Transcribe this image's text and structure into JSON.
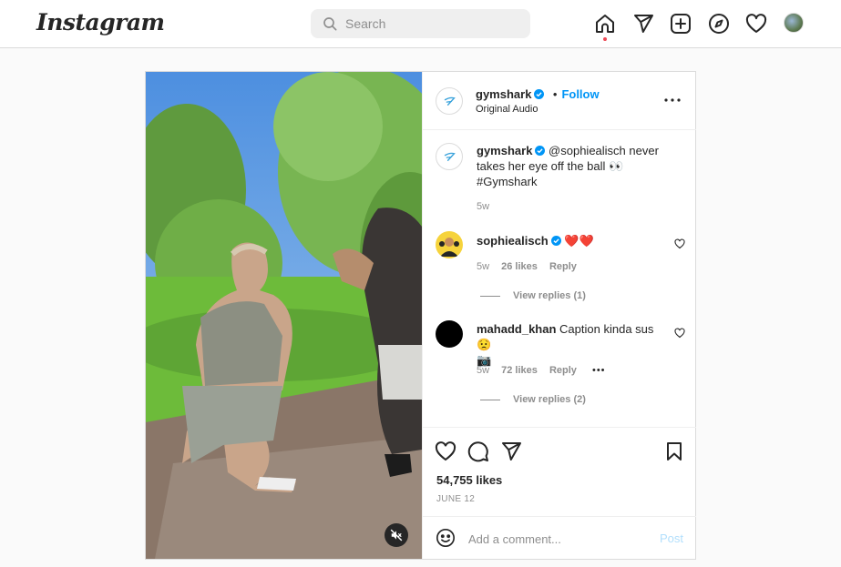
{
  "app": {
    "logo_text": "Instagram"
  },
  "nav": {
    "search_placeholder": "Search",
    "icons": [
      "home-icon",
      "direct-messages-icon",
      "new-post-icon",
      "explore-icon",
      "activity-heart-icon",
      "profile-avatar"
    ],
    "home_active_dot_color": "#ed4956"
  },
  "post": {
    "author": "gymshark",
    "follow_label": "Follow",
    "audio_label": "Original Audio",
    "caption": {
      "author": "gymshark",
      "text_line1": "@sophiealisch never",
      "text_line2": "takes her eye off the ball 👀",
      "text_line3": "#Gymshark",
      "age": "5w"
    },
    "comments": [
      {
        "author": "sophiealisch",
        "text": "❤️❤️",
        "age": "5w",
        "likes": "26 likes",
        "reply_label": "Reply",
        "view_replies": "View replies (1)"
      },
      {
        "author": "mahadd_khan",
        "text_line1": "Caption kinda sus 😟",
        "text_line2": "📷",
        "age": "5w",
        "likes": "72 likes",
        "reply_label": "Reply",
        "more": "•••",
        "view_replies": "View replies (2)"
      }
    ],
    "likes_count": "54,755 likes",
    "date": "JUNE 12",
    "add_comment_placeholder": "Add a comment...",
    "post_button": "Post",
    "colors": {
      "verified": "#0095f6",
      "follow": "#0095f6",
      "post_disabled": "#b2dffc"
    }
  }
}
